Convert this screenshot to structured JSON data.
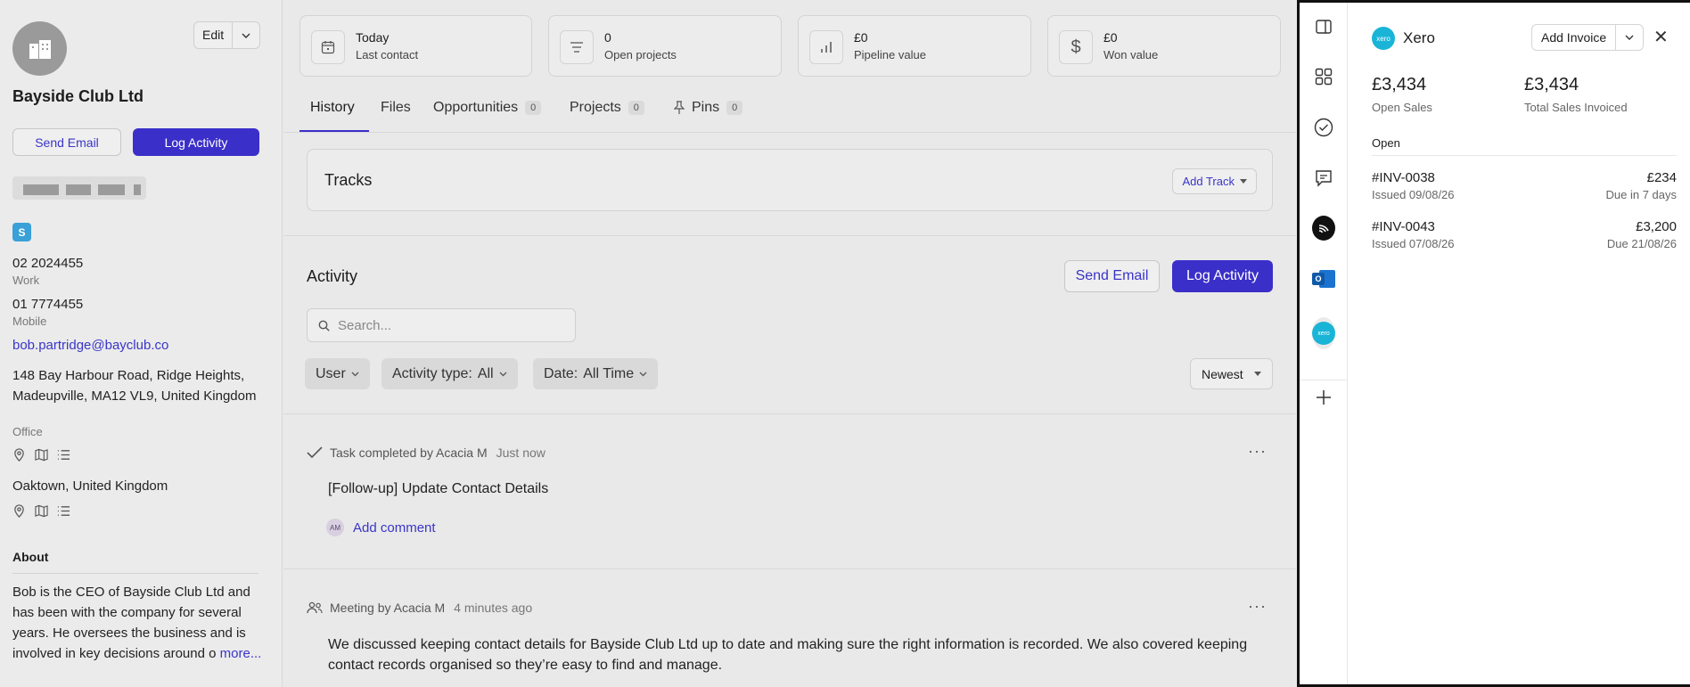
{
  "contact": {
    "company": "Bayside Club Ltd",
    "edit_label": "Edit",
    "send_email": "Send Email",
    "log_activity": "Log Activity",
    "phone_work": "02 2024455",
    "phone_work_label": "Work",
    "phone_mobile": "01 7774455",
    "phone_mobile_label": "Mobile",
    "email": "bob.partridge@bayclub.co",
    "address_line": "148 Bay Harbour Road, Ridge Heights, Madeupville, MA12 VL9, United Kingdom",
    "address_label": "Office",
    "location": "Oaktown, United Kingdom",
    "about_title": "About",
    "about_text": "Bob is the CEO of Bayside Club Ltd and has been with the company for several years. He oversees the business and is involved in key decisions around o",
    "more_link": "more..."
  },
  "stats": [
    {
      "value": "Today",
      "label": "Last contact",
      "icon": "calendar-icon"
    },
    {
      "value": "0",
      "label": "Open projects",
      "icon": "list-icon"
    },
    {
      "value": "£0",
      "label": "Pipeline value",
      "icon": "bar-chart-icon"
    },
    {
      "value": "£0",
      "label": "Won value",
      "icon": "dollar-icon"
    }
  ],
  "tabs": [
    {
      "label": "History"
    },
    {
      "label": "Files"
    },
    {
      "label": "Opportunities",
      "count": "0"
    },
    {
      "label": "Projects",
      "count": "0"
    },
    {
      "label": "Pins",
      "count": "0"
    }
  ],
  "tracks": {
    "title": "Tracks",
    "add_label": "Add Track"
  },
  "activity": {
    "title": "Activity",
    "send_email": "Send Email",
    "log_activity": "Log Activity",
    "search_placeholder": "Search...",
    "filters": {
      "user": "User",
      "type_label": "Activity type:",
      "type_value": "All",
      "date_label": "Date:",
      "date_value": "All Time"
    },
    "sort": "Newest",
    "items": [
      {
        "kind": "Task completed by Acacia M",
        "time": "Just now",
        "body": "[Follow-up] Update Contact Details",
        "avatar": "AM",
        "comment_label": "Add comment"
      },
      {
        "kind": "Meeting by Acacia M",
        "time": "4 minutes ago",
        "body": "We discussed keeping contact details for Bayside Club Ltd up to date and making sure the right information is recorded. We also covered keeping contact records organised so they’re easy to find and manage."
      }
    ]
  },
  "xero": {
    "title": "Xero",
    "add_invoice": "Add Invoice",
    "open_sales_value": "£3,434",
    "open_sales_label": "Open Sales",
    "total_value": "£3,434",
    "total_label": "Total Sales Invoiced",
    "section": "Open",
    "invoices": [
      {
        "number": "#INV-0038",
        "issued": "Issued 09/08/26",
        "amount": "£234",
        "due": "Due in 7 days"
      },
      {
        "number": "#INV-0043",
        "issued": "Issued 07/08/26",
        "amount": "£3,200",
        "due": "Due 21/08/26"
      }
    ],
    "brand_color": "#1ab4d7"
  }
}
